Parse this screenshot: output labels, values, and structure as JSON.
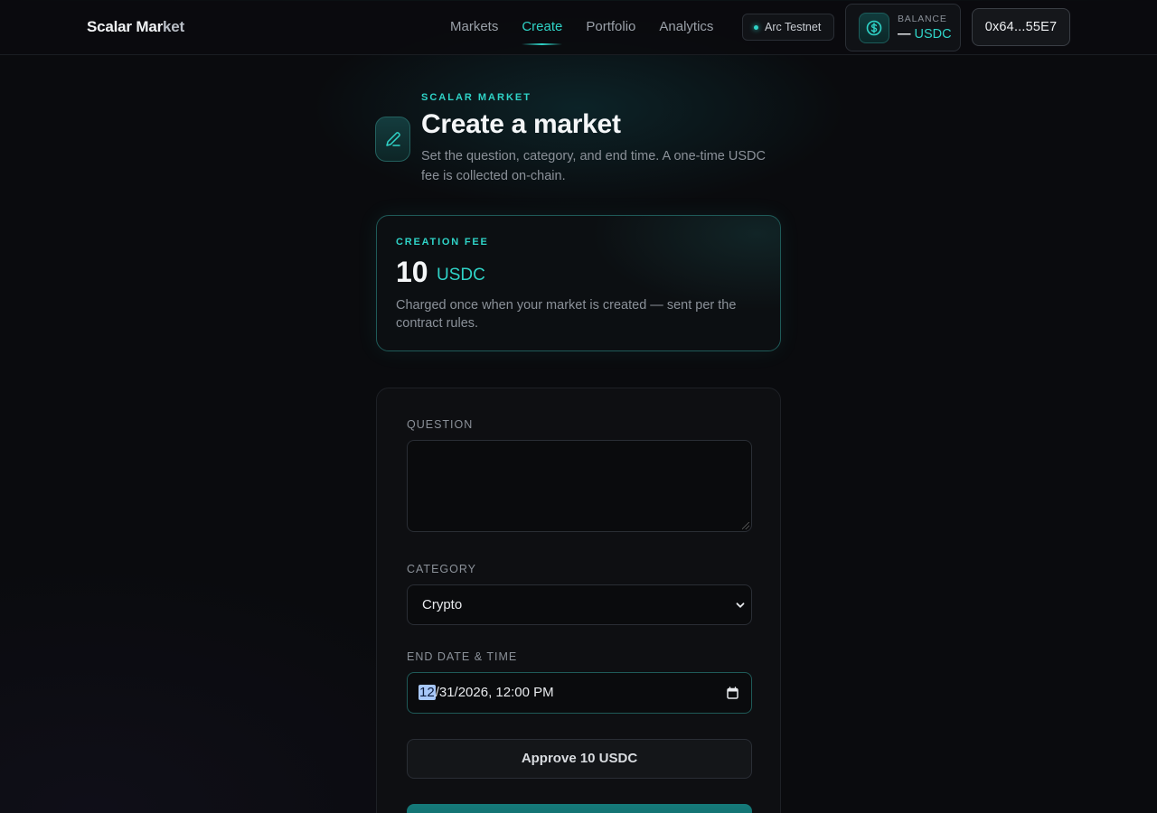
{
  "header": {
    "logo_main": "Scalar Mar",
    "logo_tail": "ket",
    "nav": [
      {
        "label": "Markets",
        "active": false
      },
      {
        "label": "Create",
        "active": true
      },
      {
        "label": "Portfolio",
        "active": false
      },
      {
        "label": "Analytics",
        "active": false
      }
    ],
    "network": "Arc Testnet",
    "balance_label": "BALANCE",
    "balance_value": "—",
    "balance_unit": "USDC",
    "wallet": "0x64...55E7"
  },
  "hero": {
    "eyebrow": "SCALAR MARKET",
    "title": "Create a market",
    "subtitle": "Set the question, category, and end time. A one-time USDC fee is collected on-chain."
  },
  "fee": {
    "label": "CREATION FEE",
    "amount": "10",
    "unit": "USDC",
    "description": "Charged once when your market is created — sent per the contract rules."
  },
  "form": {
    "question_label": "QUESTION",
    "question_value": "",
    "category_label": "CATEGORY",
    "category_value": "Crypto",
    "end_label": "END DATE & TIME",
    "end_month": "12",
    "end_rest": "/31/2026, 12:00 PM",
    "approve_label": "Approve 10 USDC"
  },
  "colors": {
    "accent": "#2fd3c7",
    "background": "#0a0b0e"
  }
}
